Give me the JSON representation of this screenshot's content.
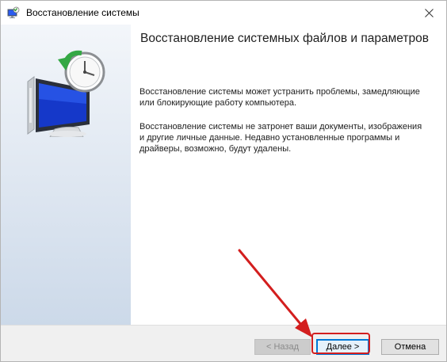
{
  "window": {
    "title": "Восстановление системы",
    "close_glyph": "✕"
  },
  "content": {
    "heading": "Восстановление системных файлов и параметров",
    "paragraph1": "Восстановление системы может устранить проблемы, замедляющие или блокирующие работу компьютера.",
    "paragraph2": "Восстановление системы не затронет ваши документы, изображения и другие личные данные. Недавно установленные программы и драйверы, возможно, будут удалены."
  },
  "footer": {
    "back_label": "< Назад",
    "next_label": "Далее >",
    "cancel_label": "Отмена"
  },
  "annotation": {
    "highlight_color": "#d31e1e",
    "target": "next-button"
  },
  "icons": {
    "app": "system-restore-icon",
    "hero": "system-restore-monitor-clock-icon",
    "close": "close-icon"
  }
}
